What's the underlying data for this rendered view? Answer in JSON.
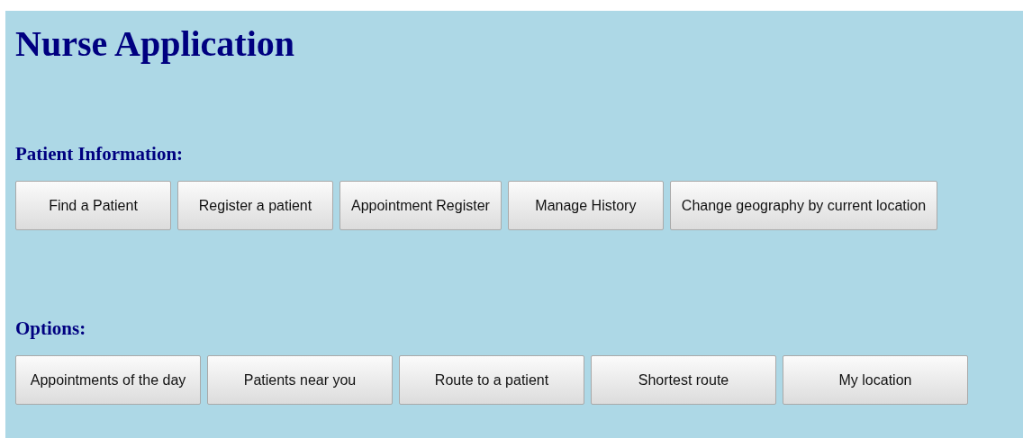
{
  "title": "Nurse Application",
  "sections": [
    {
      "heading": "Patient Information:",
      "buttons": [
        "Find a Patient",
        "Register a patient",
        "Appointment Register",
        "Manage History",
        "Change geography by current location"
      ]
    },
    {
      "heading": "Options:",
      "buttons": [
        "Appointments of the day",
        "Patients near you",
        "Route to a patient",
        "Shortest route",
        "My location"
      ]
    }
  ]
}
